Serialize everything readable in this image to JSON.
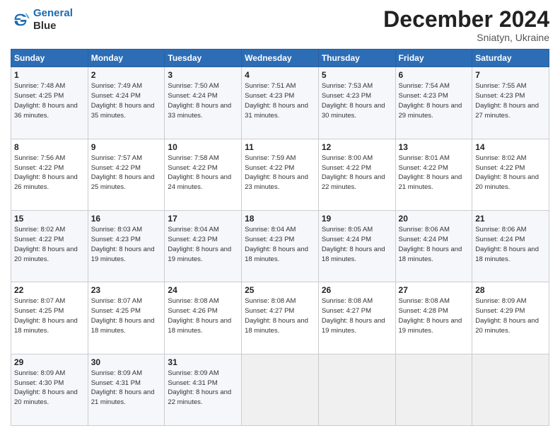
{
  "header": {
    "logo_line1": "General",
    "logo_line2": "Blue",
    "title": "December 2024",
    "subtitle": "Sniatyn, Ukraine"
  },
  "days_of_week": [
    "Sunday",
    "Monday",
    "Tuesday",
    "Wednesday",
    "Thursday",
    "Friday",
    "Saturday"
  ],
  "weeks": [
    [
      {
        "day": "1",
        "sunrise": "7:48 AM",
        "sunset": "4:25 PM",
        "daylight": "8 hours and 36 minutes."
      },
      {
        "day": "2",
        "sunrise": "7:49 AM",
        "sunset": "4:24 PM",
        "daylight": "8 hours and 35 minutes."
      },
      {
        "day": "3",
        "sunrise": "7:50 AM",
        "sunset": "4:24 PM",
        "daylight": "8 hours and 33 minutes."
      },
      {
        "day": "4",
        "sunrise": "7:51 AM",
        "sunset": "4:23 PM",
        "daylight": "8 hours and 31 minutes."
      },
      {
        "day": "5",
        "sunrise": "7:53 AM",
        "sunset": "4:23 PM",
        "daylight": "8 hours and 30 minutes."
      },
      {
        "day": "6",
        "sunrise": "7:54 AM",
        "sunset": "4:23 PM",
        "daylight": "8 hours and 29 minutes."
      },
      {
        "day": "7",
        "sunrise": "7:55 AM",
        "sunset": "4:23 PM",
        "daylight": "8 hours and 27 minutes."
      }
    ],
    [
      {
        "day": "8",
        "sunrise": "7:56 AM",
        "sunset": "4:22 PM",
        "daylight": "8 hours and 26 minutes."
      },
      {
        "day": "9",
        "sunrise": "7:57 AM",
        "sunset": "4:22 PM",
        "daylight": "8 hours and 25 minutes."
      },
      {
        "day": "10",
        "sunrise": "7:58 AM",
        "sunset": "4:22 PM",
        "daylight": "8 hours and 24 minutes."
      },
      {
        "day": "11",
        "sunrise": "7:59 AM",
        "sunset": "4:22 PM",
        "daylight": "8 hours and 23 minutes."
      },
      {
        "day": "12",
        "sunrise": "8:00 AM",
        "sunset": "4:22 PM",
        "daylight": "8 hours and 22 minutes."
      },
      {
        "day": "13",
        "sunrise": "8:01 AM",
        "sunset": "4:22 PM",
        "daylight": "8 hours and 21 minutes."
      },
      {
        "day": "14",
        "sunrise": "8:02 AM",
        "sunset": "4:22 PM",
        "daylight": "8 hours and 20 minutes."
      }
    ],
    [
      {
        "day": "15",
        "sunrise": "8:02 AM",
        "sunset": "4:22 PM",
        "daylight": "8 hours and 20 minutes."
      },
      {
        "day": "16",
        "sunrise": "8:03 AM",
        "sunset": "4:23 PM",
        "daylight": "8 hours and 19 minutes."
      },
      {
        "day": "17",
        "sunrise": "8:04 AM",
        "sunset": "4:23 PM",
        "daylight": "8 hours and 19 minutes."
      },
      {
        "day": "18",
        "sunrise": "8:04 AM",
        "sunset": "4:23 PM",
        "daylight": "8 hours and 18 minutes."
      },
      {
        "day": "19",
        "sunrise": "8:05 AM",
        "sunset": "4:24 PM",
        "daylight": "8 hours and 18 minutes."
      },
      {
        "day": "20",
        "sunrise": "8:06 AM",
        "sunset": "4:24 PM",
        "daylight": "8 hours and 18 minutes."
      },
      {
        "day": "21",
        "sunrise": "8:06 AM",
        "sunset": "4:24 PM",
        "daylight": "8 hours and 18 minutes."
      }
    ],
    [
      {
        "day": "22",
        "sunrise": "8:07 AM",
        "sunset": "4:25 PM",
        "daylight": "8 hours and 18 minutes."
      },
      {
        "day": "23",
        "sunrise": "8:07 AM",
        "sunset": "4:25 PM",
        "daylight": "8 hours and 18 minutes."
      },
      {
        "day": "24",
        "sunrise": "8:08 AM",
        "sunset": "4:26 PM",
        "daylight": "8 hours and 18 minutes."
      },
      {
        "day": "25",
        "sunrise": "8:08 AM",
        "sunset": "4:27 PM",
        "daylight": "8 hours and 18 minutes."
      },
      {
        "day": "26",
        "sunrise": "8:08 AM",
        "sunset": "4:27 PM",
        "daylight": "8 hours and 19 minutes."
      },
      {
        "day": "27",
        "sunrise": "8:08 AM",
        "sunset": "4:28 PM",
        "daylight": "8 hours and 19 minutes."
      },
      {
        "day": "28",
        "sunrise": "8:09 AM",
        "sunset": "4:29 PM",
        "daylight": "8 hours and 20 minutes."
      }
    ],
    [
      {
        "day": "29",
        "sunrise": "8:09 AM",
        "sunset": "4:30 PM",
        "daylight": "8 hours and 20 minutes."
      },
      {
        "day": "30",
        "sunrise": "8:09 AM",
        "sunset": "4:31 PM",
        "daylight": "8 hours and 21 minutes."
      },
      {
        "day": "31",
        "sunrise": "8:09 AM",
        "sunset": "4:31 PM",
        "daylight": "8 hours and 22 minutes."
      },
      null,
      null,
      null,
      null
    ]
  ]
}
